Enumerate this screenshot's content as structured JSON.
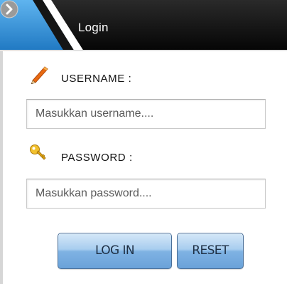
{
  "header": {
    "title": "Login",
    "icon": "chevron-right-circle-icon"
  },
  "form": {
    "username": {
      "label": "USERNAME :",
      "icon": "pencil-icon",
      "placeholder": "Masukkan username....",
      "value": ""
    },
    "password": {
      "label": "PASSWORD :",
      "icon": "key-icon",
      "placeholder": "Masukkan password....",
      "value": ""
    }
  },
  "buttons": {
    "login_label": "LOG IN",
    "reset_label": "RESET"
  },
  "colors": {
    "header_dark": "#0d0d0d",
    "header_accent": "#2f8fd6",
    "button_blue": "#7fb2e3",
    "pencil_orange": "#e86a12",
    "key_gold": "#e1a514"
  }
}
